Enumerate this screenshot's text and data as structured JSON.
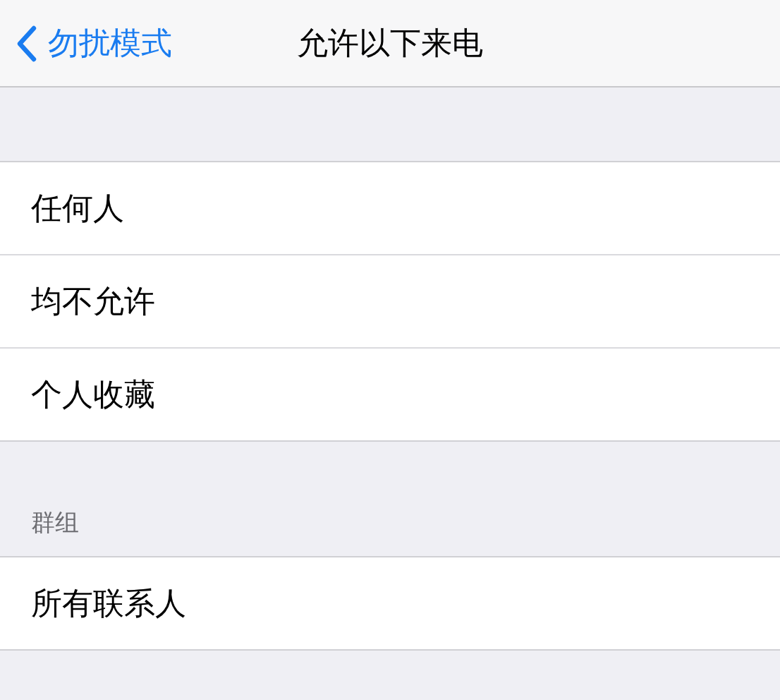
{
  "nav_bar": {
    "back_label": "勿扰模式",
    "title": "允许以下来电"
  },
  "options": [
    {
      "label": "任何人"
    },
    {
      "label": "均不允许"
    },
    {
      "label": "个人收藏"
    }
  ],
  "groups": {
    "header": "群组",
    "items": [
      {
        "label": "所有联系人"
      }
    ]
  }
}
